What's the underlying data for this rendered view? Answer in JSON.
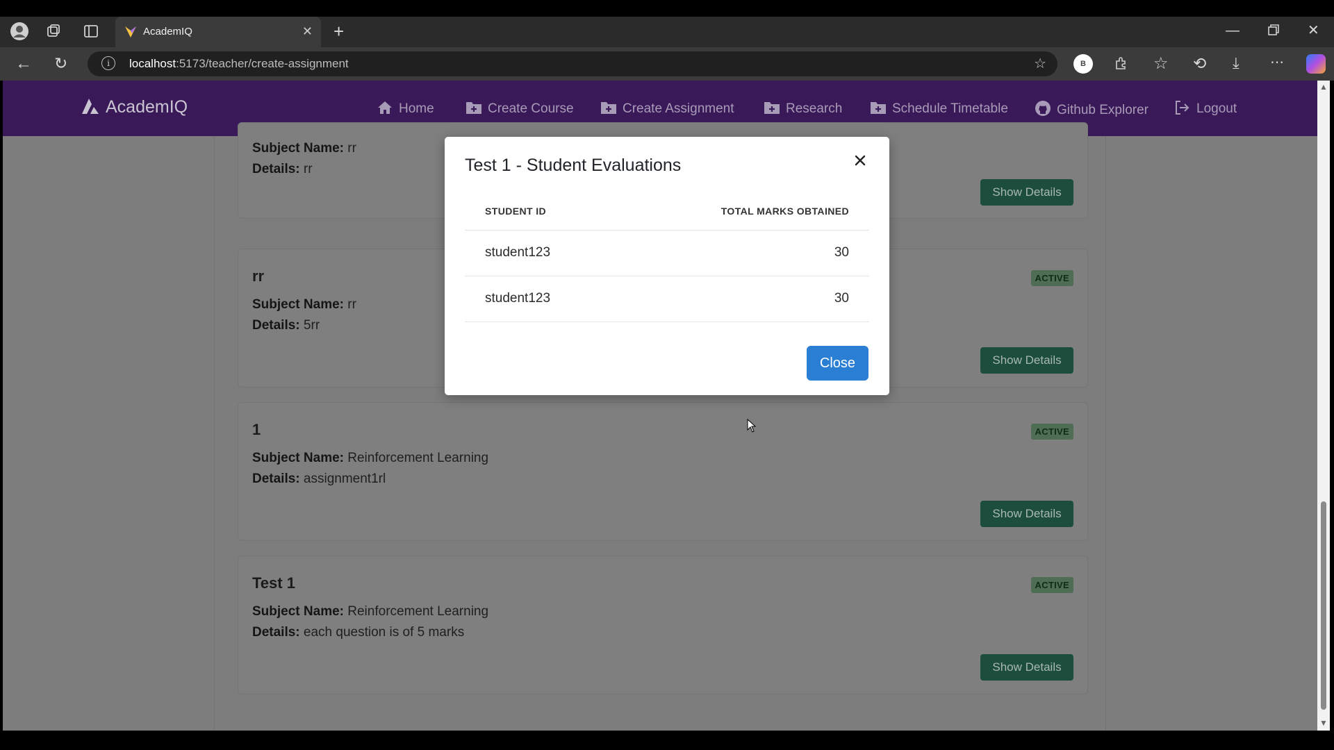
{
  "browser": {
    "tab_title": "AcademIQ",
    "url_host": "localhost",
    "url_path": ":5173/teacher/create-assignment",
    "profile_initial": "B"
  },
  "navbar": {
    "brand": "AcademIQ",
    "items": [
      {
        "label": "Home",
        "icon": "home-icon"
      },
      {
        "label": "Create Course",
        "icon": "folder-plus-icon"
      },
      {
        "label": "Create Assignment",
        "icon": "folder-plus-icon"
      },
      {
        "label": "Research",
        "icon": "folder-plus-icon"
      },
      {
        "label": "Schedule Timetable",
        "icon": "folder-plus-icon"
      },
      {
        "label": "Github Explorer",
        "icon": "github-icon"
      },
      {
        "label": "Logout",
        "icon": "logout-icon"
      }
    ]
  },
  "labels": {
    "subject_name": "Subject Name:",
    "details": "Details:",
    "show_details": "Show Details",
    "active": "ACTIVE"
  },
  "assignments": [
    {
      "title": "",
      "subject": "rr",
      "details": "rr",
      "status": ""
    },
    {
      "title": "rr",
      "subject": "rr",
      "details": "5rr",
      "status": "ACTIVE"
    },
    {
      "title": "1",
      "subject": "Reinforcement Learning",
      "details": "assignment1rl",
      "status": "ACTIVE"
    },
    {
      "title": "Test 1",
      "subject": "Reinforcement Learning",
      "details": "each question is of 5 marks",
      "status": "ACTIVE"
    }
  ],
  "modal": {
    "title": "Test 1 - Student Evaluations",
    "col_student_id": "STUDENT ID",
    "col_total_marks": "TOTAL MARKS OBTAINED",
    "rows": [
      {
        "student_id": "student123",
        "marks": "30"
      },
      {
        "student_id": "student123",
        "marks": "30"
      }
    ],
    "close_label": "Close"
  },
  "colors": {
    "navbar_bg": "#3a1958",
    "primary_button": "#2a7fd4",
    "show_details_button": "#1d4d3c"
  }
}
